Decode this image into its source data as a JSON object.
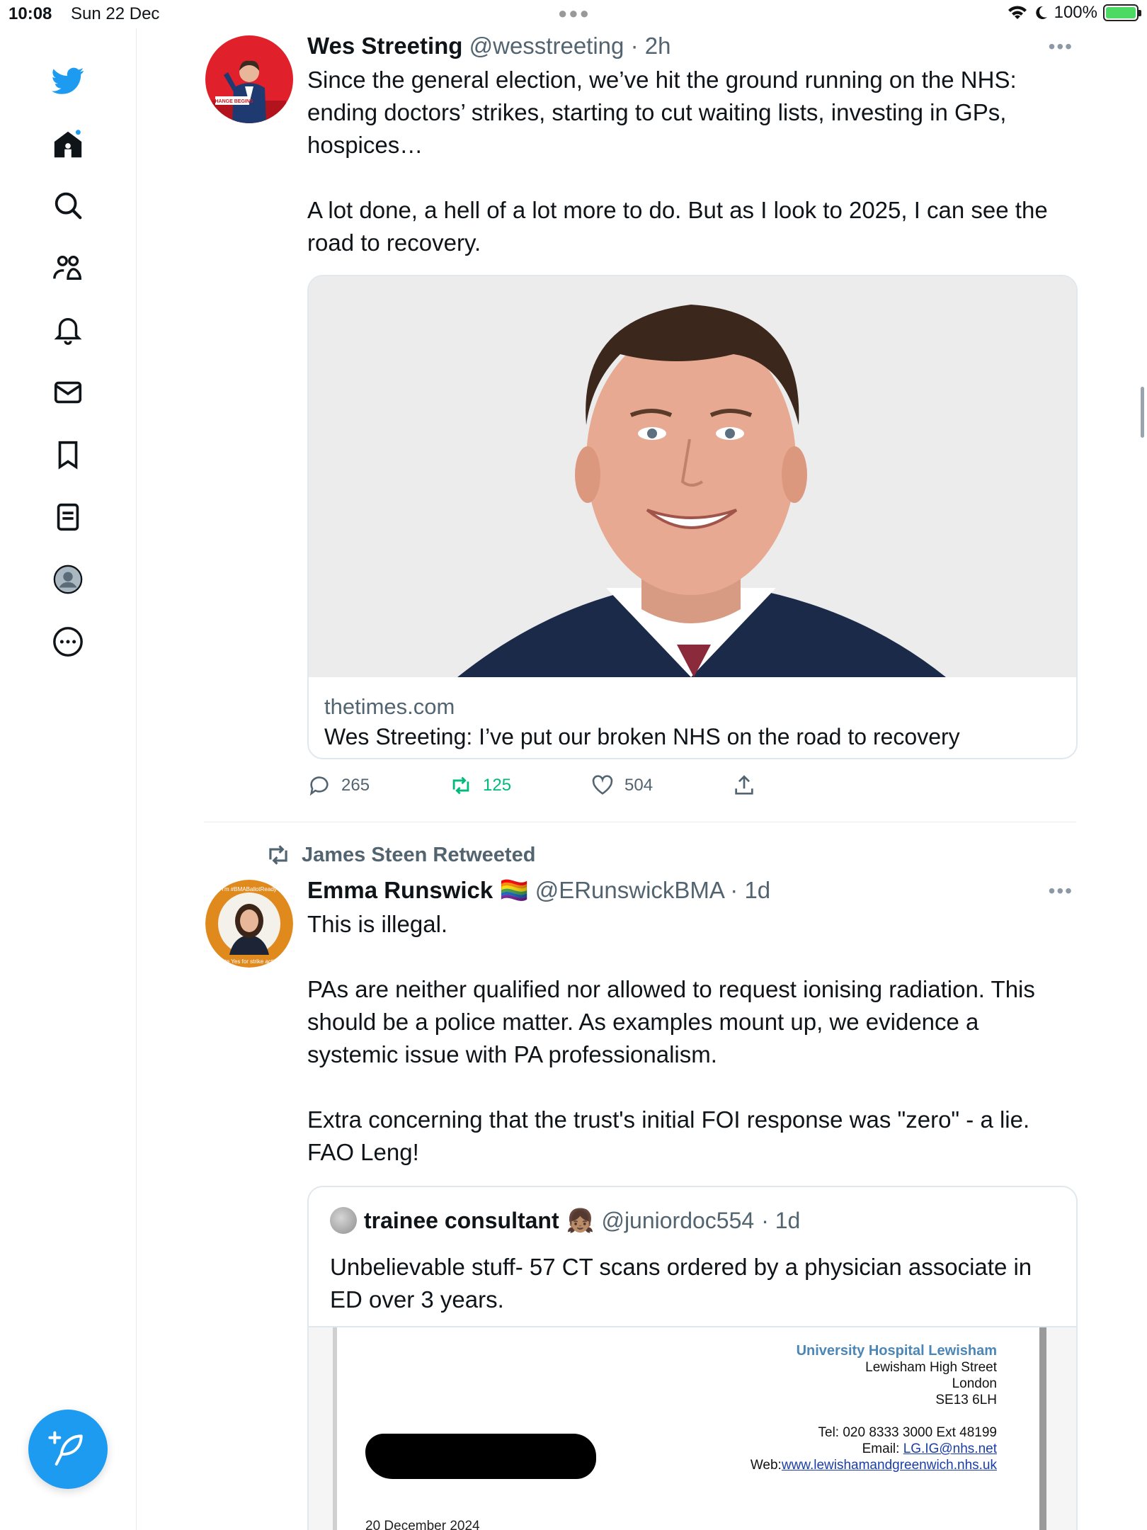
{
  "status_bar": {
    "time": "10:08",
    "date": "Sun 22 Dec",
    "battery": "100%"
  },
  "sidebar": {
    "icons": [
      "twitter-bird-icon",
      "home-icon",
      "search-icon",
      "communities-icon",
      "notifications-icon",
      "messages-icon",
      "bookmarks-icon",
      "lists-icon",
      "profile-icon",
      "more-icon"
    ],
    "compose_icon": "compose-tweet-icon",
    "accent": "#1d9bf0"
  },
  "tweet1": {
    "name": "Wes Streeting",
    "handle": "@wesstreeting",
    "time": "· 2h",
    "text": "Since the general election, we’ve hit the ground running on the NHS: ending doctors’ strikes, starting to cut waiting lists, investing in GPs, hospices…\n\nA lot done, a hell of a lot more to do. But as I look to 2025, I can see the road to recovery.",
    "avatar_badge": "CHANGE BEGINS",
    "card": {
      "domain": "thetimes.com",
      "title": "Wes Streeting: I’ve put our broken NHS on the road to recovery"
    },
    "actions": {
      "replies": "265",
      "retweets": "125",
      "likes": "504"
    }
  },
  "tweet2": {
    "retweeted_by": "James Steen Retweeted",
    "name": "Emma Runswick",
    "flag": "🏳️‍🌈",
    "handle": "@ERunswickBMA",
    "time": "· 1d",
    "avatar_ring_top": "I'm #BMABallotReady",
    "avatar_ring_bottom": "Vote Yes for strike action",
    "text": "This is illegal.\n\nPAs are neither qualified nor allowed to request ionising radiation. This should be a police matter. As examples mount up, we evidence a systemic issue with PA professionalism.\n\nExtra concerning that the trust's initial FOI response was \"zero\" - a lie. FAO Leng!",
    "quote": {
      "name": "trainee consultant",
      "emoji": "👧🏽",
      "handle": "@juniordoc554",
      "time": "· 1d",
      "text": "Unbelievable stuff- 57 CT scans ordered by a physician associate in ED over 3 years.",
      "document": {
        "org": "University Hospital Lewisham",
        "address": [
          "Lewisham High Street",
          "London",
          "SE13 6LH"
        ],
        "tel": "Tel: 020 8333 3000 Ext 48199",
        "email_label": "Email:",
        "email": "LG.IG@nhs.net",
        "web_label": "Web:",
        "web": "www.lewishamandgreenwich.nhs.uk",
        "date": "20 December 2024"
      }
    }
  }
}
